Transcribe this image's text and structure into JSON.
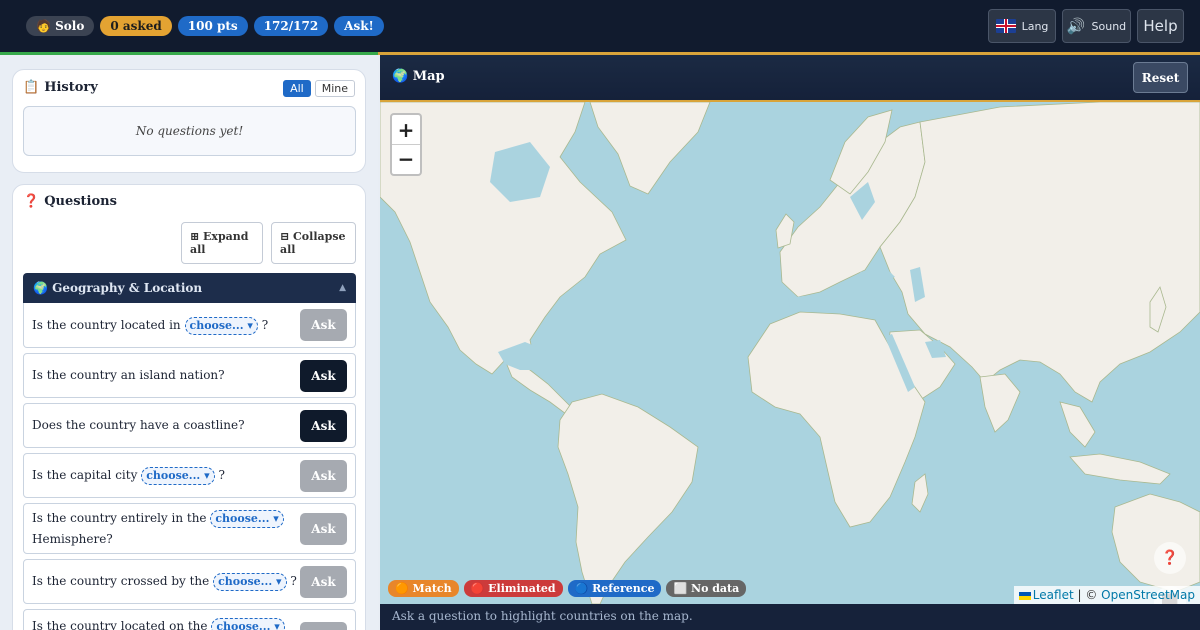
{
  "topbar": {
    "mode": "🧑 Solo",
    "asked": "0 asked",
    "points": "100 pts",
    "remaining": "172/172",
    "ask_cta": "Ask!",
    "lang_label": "Lang",
    "sound_label": "Sound",
    "help_label": "Help"
  },
  "history": {
    "title": "History",
    "filter_all": "All",
    "filter_mine": "Mine",
    "empty_text": "No questions yet!"
  },
  "questions": {
    "title": "Questions",
    "expand_all": "⊞ Expand all",
    "collapse_all": "⊟ Collapse all",
    "group_label": "🌍 Geography & Location",
    "choose_label": "choose... ▾",
    "ask_label": "Ask",
    "items": [
      {
        "pre": "Is the country located in",
        "post": "?"
      },
      {
        "pre": "Is the country an island nation?"
      },
      {
        "pre": "Does the country have a coastline?"
      },
      {
        "pre": "Is the capital city",
        "post": "?"
      },
      {
        "pre": "Is the country entirely in the",
        "post": "Hemisphere?"
      },
      {
        "pre": "Is the country crossed by the",
        "post": "?"
      },
      {
        "pre": "Is the country located on the"
      }
    ]
  },
  "map": {
    "title": "🌍 Map",
    "reset_label": "Reset",
    "zoom_in": "+",
    "zoom_out": "−",
    "legend": {
      "match": "🟠 Match",
      "eliminated": "🔴 Eliminated",
      "reference": "🔵 Reference",
      "no_data": "⬜ No data"
    },
    "attribution": {
      "leaflet": "Leaflet",
      "separator": " | © ",
      "osm": "OpenStreetMap"
    },
    "footer_hint": "Ask a question to highlight countries on the map.",
    "help_glyph": "❓"
  },
  "colors": {
    "water": "#aad3df",
    "land": "#f2efe9",
    "match": "#e8862a",
    "eliminated": "#cc3b3b",
    "reference": "#1f6ac7",
    "no_data": "#666666"
  }
}
